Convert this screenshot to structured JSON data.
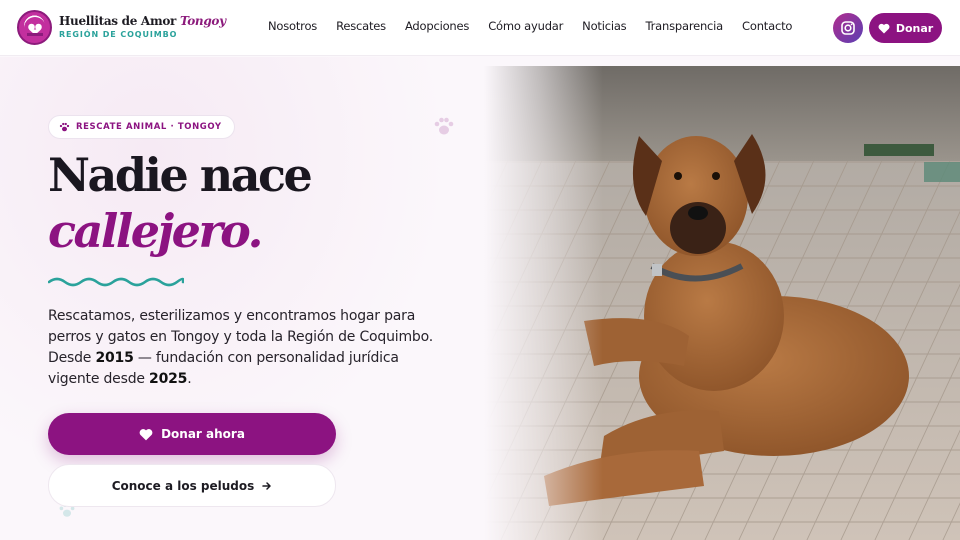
{
  "brand": {
    "name_main": "Huellitas de Amor ",
    "name_accent": "Tongoy",
    "subtitle": "REGIÓN DE COQUIMBO"
  },
  "nav": {
    "items": [
      {
        "label": "Nosotros"
      },
      {
        "label": "Rescates"
      },
      {
        "label": "Adopciones"
      },
      {
        "label": "Cómo ayudar"
      },
      {
        "label": "Noticias"
      },
      {
        "label": "Transparencia"
      },
      {
        "label": "Contacto"
      }
    ],
    "donate_label": "Donar",
    "instagram_icon": "instagram-icon"
  },
  "hero": {
    "tag": "RESCATE ANIMAL · TONGOY",
    "title_line1": "Nadie nace",
    "title_line2": "callejero.",
    "lead_part1": "Rescatamos, esterilizamos y encontramos hogar para perros y gatos en Tongoy y toda la Región de Coquimbo. Desde ",
    "lead_year1": "2015",
    "lead_part2": " — fundación con personalidad jurídica vigente desde ",
    "lead_year2": "2025",
    "lead_part3": ".",
    "primary_cta": "Donar ahora",
    "secondary_cta": "Conoce a los peludos"
  },
  "colors": {
    "brand_purple": "#8c1381",
    "brand_teal": "#2aa29b",
    "text_dark": "#1d1b22"
  }
}
